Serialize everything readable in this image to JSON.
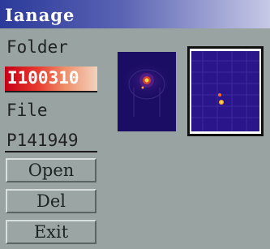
{
  "window": {
    "title": "Ianage"
  },
  "folder": {
    "label": "Folder",
    "value": "I100310"
  },
  "file": {
    "label": "File",
    "value": "P141949"
  },
  "buttons": {
    "open": "Open",
    "del": "Del",
    "exit": "Exit"
  },
  "thumbnails": [
    {
      "name": "thermal-image-1",
      "selected": false
    },
    {
      "name": "thermal-image-2",
      "selected": true
    }
  ],
  "colors": {
    "background": "#98a3a2",
    "title_bar": "#2b3a9a",
    "folder_highlight": "#c60016",
    "thumbnail_bg": "#2a168a",
    "hotspot": "#f5a623"
  }
}
